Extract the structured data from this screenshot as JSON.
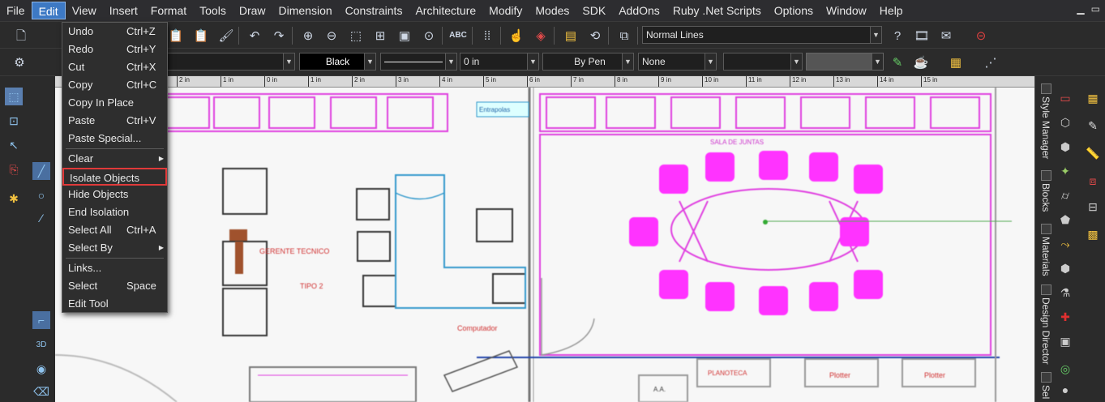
{
  "menubar": {
    "items": [
      "File",
      "Edit",
      "View",
      "Insert",
      "Format",
      "Tools",
      "Draw",
      "Dimension",
      "Constraints",
      "Architecture",
      "Modify",
      "Modes",
      "SDK",
      "AddOns",
      "Ruby .Net Scripts",
      "Options",
      "Window",
      "Help"
    ],
    "active_index": 1,
    "window_controls": [
      "▁",
      "▭"
    ]
  },
  "toolbar1": {
    "line_style_select": "Normal Lines"
  },
  "toolbar2": {
    "layer_value": "0",
    "color_select": "Black",
    "thickness_select": "0 in",
    "pen_select": "By Pen",
    "fill_select": "None"
  },
  "ruler": {
    "ticks": [
      "2 in",
      "1 in",
      "0 in",
      "1 in",
      "2 in",
      "3 in",
      "4 in",
      "5 in",
      "6 in",
      "7 in",
      "8 in",
      "9 in",
      "10 in",
      "11 in",
      "12 in",
      "13 in",
      "14 in",
      "15 in"
    ]
  },
  "drawing": {
    "labels": [
      "Entrapolas",
      "SALA DE JUNTAS",
      "GERENTE TECNICO",
      "TIPO 2",
      "Computador",
      "PLANOTECA",
      "Plotter",
      "Plotter",
      "A.A."
    ]
  },
  "right_tabs": [
    "Style Manager",
    "Blocks",
    "Materials",
    "Design Director",
    "Sel"
  ],
  "edit_menu": {
    "items": [
      {
        "label": "Undo",
        "shortcut": "Ctrl+Z"
      },
      {
        "label": "Redo",
        "shortcut": "Ctrl+Y"
      },
      {
        "label": "Cut",
        "shortcut": "Ctrl+X"
      },
      {
        "label": "Copy",
        "shortcut": "Ctrl+C"
      },
      {
        "label": "Copy In Place",
        "shortcut": ""
      },
      {
        "label": "Paste",
        "shortcut": "Ctrl+V"
      },
      {
        "label": "Paste Special...",
        "shortcut": ""
      },
      {
        "label": "Clear",
        "shortcut": "",
        "submenu": true
      },
      {
        "label": "Isolate Objects",
        "shortcut": "",
        "highlighted": true
      },
      {
        "label": "Hide Objects",
        "shortcut": ""
      },
      {
        "label": "End Isolation",
        "shortcut": ""
      },
      {
        "label": "Select All",
        "shortcut": "Ctrl+A"
      },
      {
        "label": "Select By",
        "shortcut": "",
        "submenu": true
      },
      {
        "label": "Links...",
        "shortcut": ""
      },
      {
        "label": "Select",
        "shortcut": "Space"
      },
      {
        "label": "Edit Tool",
        "shortcut": ""
      }
    ]
  },
  "colors": {
    "accent": "#3d79c4",
    "highlight_box": "#e03a3a",
    "furniture_magenta": "#ff33ff",
    "wall_blue": "#3399cc"
  }
}
